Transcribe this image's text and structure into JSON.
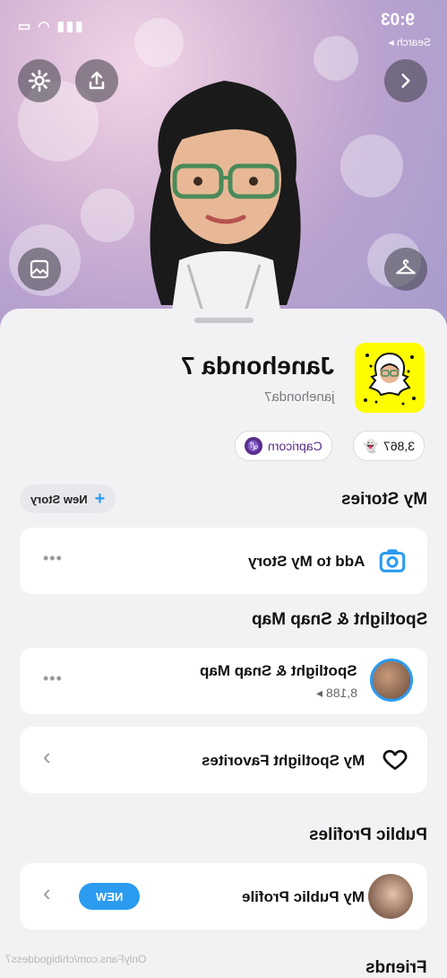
{
  "status_bar": {
    "time": "9:03",
    "back_label": "Search"
  },
  "profile": {
    "display_name": "Janehonda 7",
    "username": "janehonda7",
    "zodiac": "Capricorn",
    "score": "3,867"
  },
  "stories": {
    "title": "My Stories",
    "new_story_label": "New Story",
    "add_story_label": "Add to My Story"
  },
  "spotlight": {
    "title": "Spotlight & Snap Map",
    "item_label": "Spotlight & Snap Map",
    "item_views": "8,188",
    "favorites_label": "My Spotlight Favorites"
  },
  "public_profiles": {
    "title": "Public Profiles",
    "item_label": "My Public Profile",
    "badge": "NEW"
  },
  "friends": {
    "title": "Friends"
  },
  "watermark": "OnlyFans.com/chibigoddess7",
  "colors": {
    "accent": "#2b9bf0",
    "snapcode": "#fffc00",
    "zodiac": "#5b2c8a"
  }
}
